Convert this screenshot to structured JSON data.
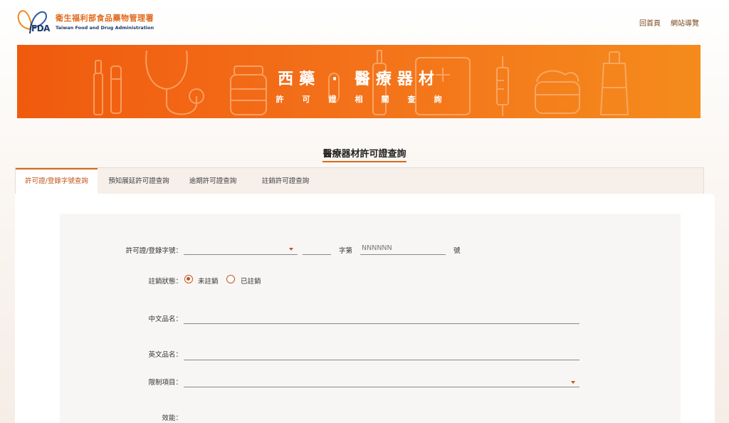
{
  "header": {
    "org_name_cn": "衛生福利部食品藥物管理署",
    "org_name_en": "Taiwan Food and Drug Administration",
    "logo_mark": "FDA",
    "nav": [
      "回首頁",
      "網站導覽"
    ]
  },
  "banner": {
    "title": "西藥 · 醫療器材",
    "subtitle": "許可證相關查詢"
  },
  "page_title": "醫療器材許可證查詢",
  "tabs": [
    {
      "label": "許可證/登錄字號查詢",
      "active": true
    },
    {
      "label": "預知展延許可證查詢",
      "active": false
    },
    {
      "label": "逾期許可證查詢",
      "active": false
    },
    {
      "label": "註銷許可證查詢",
      "active": false
    }
  ],
  "form": {
    "license_label": "許可證/登錄字號：",
    "license_prefix_value": "",
    "license_word_value": "",
    "license_char_label": "字第",
    "license_number_placeholder": "NNNNNN",
    "license_suffix": "號",
    "cancel_status_label": "註銷狀態：",
    "cancel_options": [
      {
        "label": "未註銷",
        "checked": true
      },
      {
        "label": "已註銷",
        "checked": false
      }
    ],
    "chinese_name_label": "中文品名：",
    "chinese_name_value": "",
    "english_name_label": "英文品名：",
    "english_name_value": "",
    "restriction_label": "限制項目：",
    "restriction_value": "",
    "efficacy_label": "效能："
  },
  "colors": {
    "accent": "#d46b1c",
    "banner_start": "#f05a0e",
    "banner_end": "#f58b1c"
  }
}
